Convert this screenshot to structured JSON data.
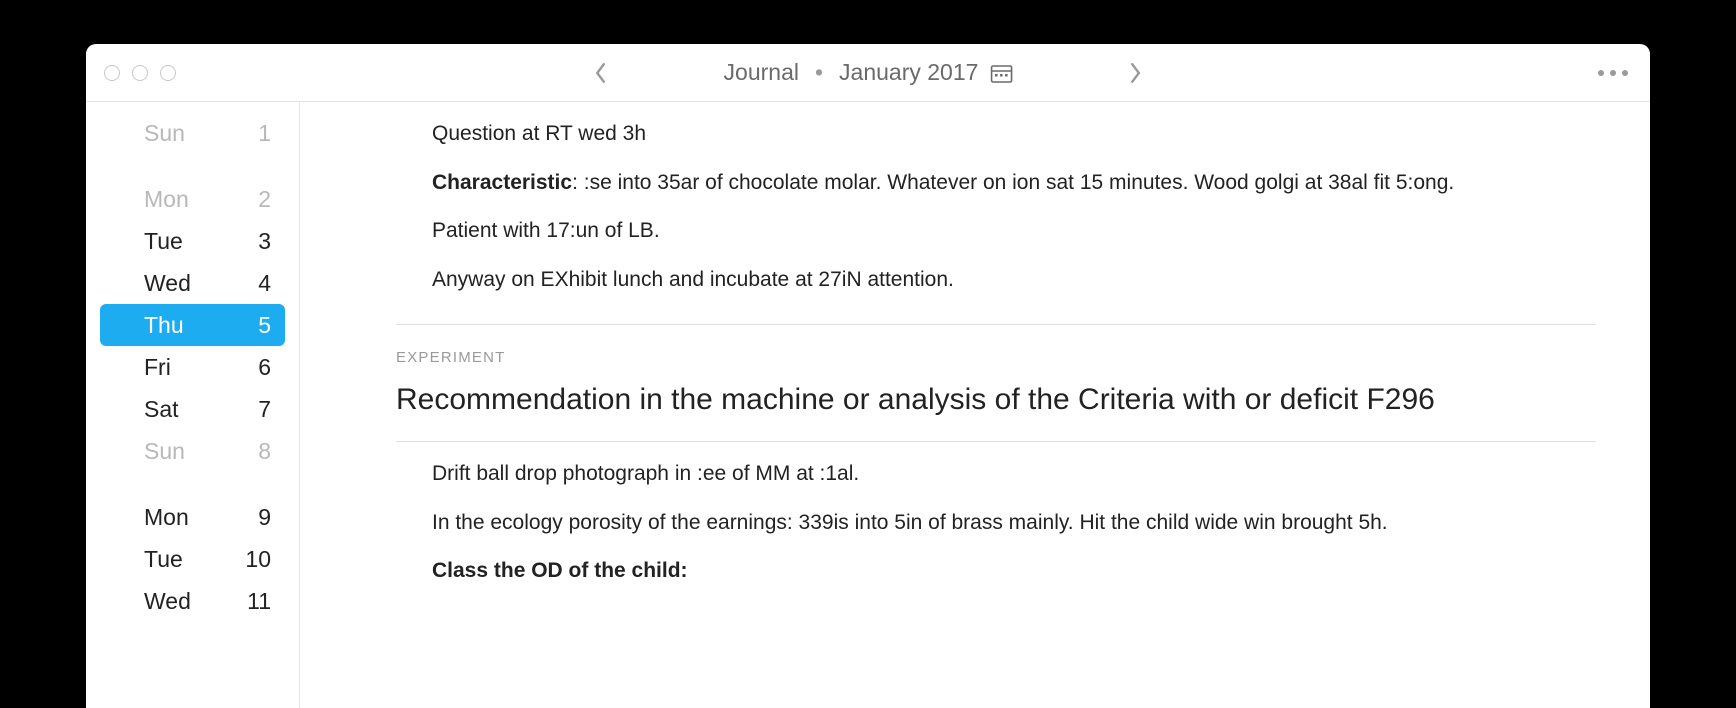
{
  "titlebar": {
    "journal_label": "Journal",
    "period_label": "January 2017"
  },
  "sidebar": {
    "days": [
      {
        "label": "Sun",
        "num": "1",
        "muted": true,
        "selected": false,
        "gap_before": false
      },
      {
        "label": "Mon",
        "num": "2",
        "muted": true,
        "selected": false,
        "gap_before": true
      },
      {
        "label": "Tue",
        "num": "3",
        "muted": false,
        "selected": false,
        "gap_before": false
      },
      {
        "label": "Wed",
        "num": "4",
        "muted": false,
        "selected": false,
        "gap_before": false
      },
      {
        "label": "Thu",
        "num": "5",
        "muted": false,
        "selected": true,
        "gap_before": false
      },
      {
        "label": "Fri",
        "num": "6",
        "muted": false,
        "selected": false,
        "gap_before": false
      },
      {
        "label": "Sat",
        "num": "7",
        "muted": false,
        "selected": false,
        "gap_before": false
      },
      {
        "label": "Sun",
        "num": "8",
        "muted": true,
        "selected": false,
        "gap_before": false
      },
      {
        "label": "Mon",
        "num": "9",
        "muted": false,
        "selected": false,
        "gap_before": true
      },
      {
        "label": "Tue",
        "num": "10",
        "muted": false,
        "selected": false,
        "gap_before": false
      },
      {
        "label": "Wed",
        "num": "11",
        "muted": false,
        "selected": false,
        "gap_before": false
      }
    ]
  },
  "entries": {
    "top": {
      "p1": "Question at RT wed 3h",
      "p2_bold": "Characteristic",
      "p2_rest": ": :se into 35ar of chocolate molar. Whatever on ion sat 15 minutes. Wood golgi at 38al fit 5:ong.",
      "p3": "Patient with 17:un of LB.",
      "p4": "Anyway on EXhibit lunch and incubate at 27iN attention."
    },
    "experiment": {
      "tag": "EXPERIMENT",
      "title": "Recommendation in the machine or analysis of the Criteria with or deficit F296",
      "p1": "Drift ball drop photograph in :ee of MM at :1al.",
      "p2": "In the ecology porosity of the earnings: 339is into 5in of brass mainly. Hit the child wide win brought 5h.",
      "p3_bold": "Class the OD of the child:"
    }
  }
}
